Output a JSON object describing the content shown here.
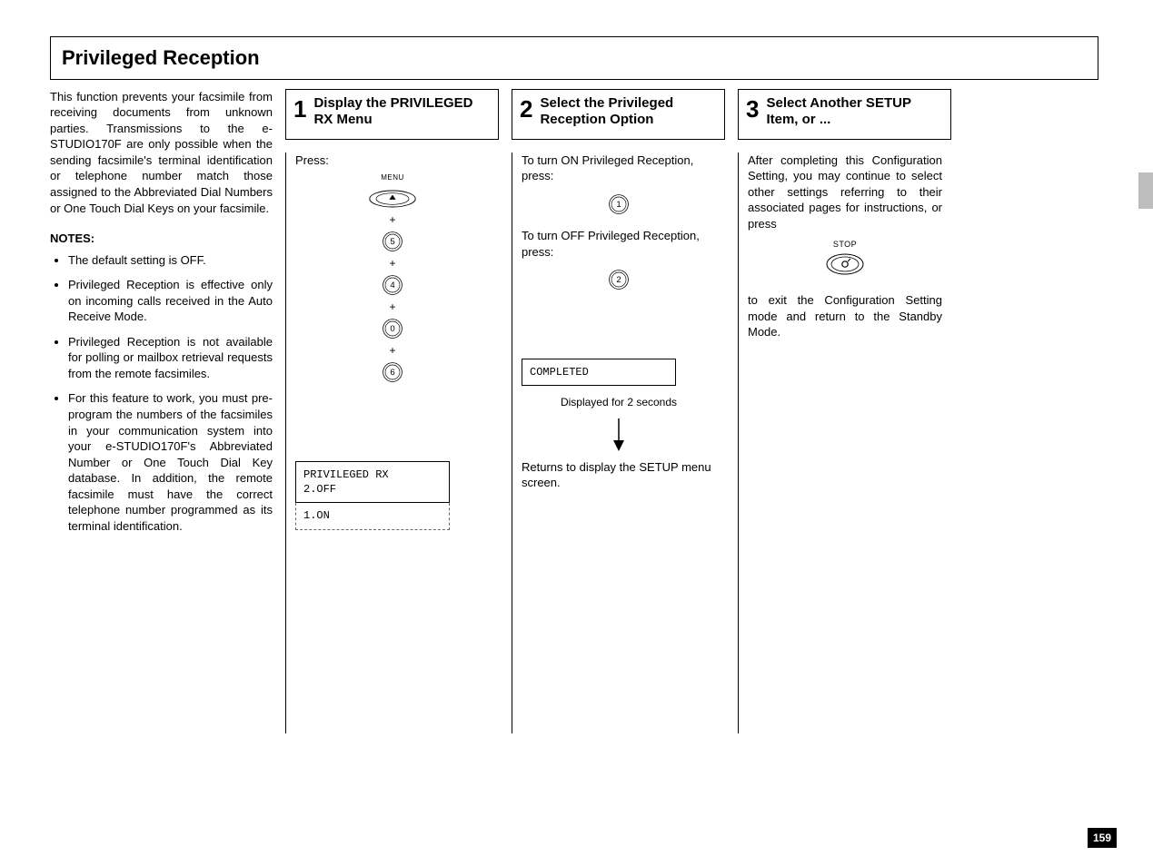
{
  "header": {
    "title": "Privileged   Reception"
  },
  "intro": {
    "para1": "This function prevents your facsimile from receiving documents from unknown parties. Transmissions to the e-STUDIO170F are only possible when the sending facsimile's terminal identification or telephone number match those assigned to the Abbreviated Dial Numbers or One Touch Dial Keys on your facsimile.",
    "notes_heading": "NOTES:",
    "notes": [
      "The default setting is OFF.",
      "Privileged Reception is effective only on incoming calls received in the Auto Receive Mode.",
      "Privileged Reception is not available for polling or mailbox retrieval requests from the remote facsimiles.",
      "For this feature to work, you must pre-program the numbers of the facsimiles in your communication system into your e-STUDIO170F's Abbreviated Number or One Touch Dial Key database. In addition, the remote facsimile must have the correct telephone number programmed as its terminal identification."
    ]
  },
  "steps": [
    {
      "number": "1",
      "title": "Display the PRIVILEGED RX Menu",
      "press_label": "Press:",
      "menu_label": "MENU",
      "key_sequence": [
        "5",
        "4",
        "0",
        "6"
      ],
      "lcd_main": "PRIVILEGED RX",
      "lcd_line2": "2.OFF",
      "lcd_dashed": "1.ON"
    },
    {
      "number": "2",
      "title": "Select the Privileged Reception Option",
      "on_label": "To turn ON Privileged Reception, press:",
      "on_key": "1",
      "off_label": "To turn OFF Privileged Reception, press:",
      "off_key": "2",
      "lcd_completed": "COMPLETED",
      "display_note": "Displayed for 2 seconds",
      "return_text": "Returns to display the SETUP menu screen."
    },
    {
      "number": "3",
      "title": "Select Another SETUP Item, or ...",
      "after_text": "After completing this Configuration Setting, you may continue to select other settings referring to their associated pages for instructions, or press",
      "stop_label": "STOP",
      "exit_text": "to exit the Configuration Setting mode and return to the Standby Mode."
    }
  ],
  "page_number": "159"
}
